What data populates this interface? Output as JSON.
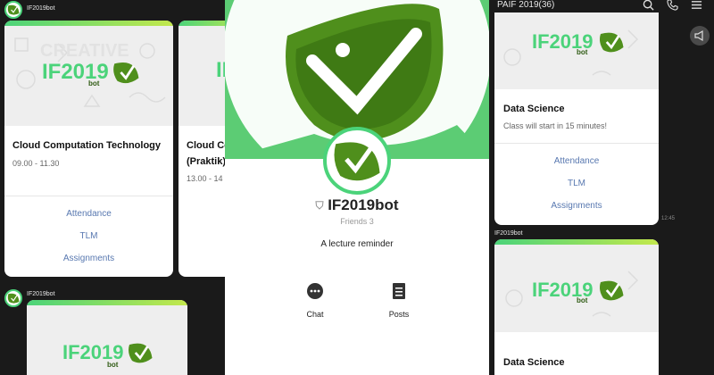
{
  "left": {
    "sender_top": "IF2019bot",
    "sender_bottom": "IF2019bot",
    "cards": [
      {
        "title": "Cloud Computation Technology",
        "time": "09.00 - 11.30",
        "actions": [
          "Attendance",
          "TLM",
          "Assignments"
        ]
      },
      {
        "title_line1": "Cloud Co",
        "title_line2": "(Praktik)",
        "time": "13.00 - 14"
      }
    ]
  },
  "logo": {
    "word": "IF2019",
    "sub": "bot"
  },
  "profile": {
    "name": "IF2019bot",
    "friends": "Friends 3",
    "description": "A lecture reminder",
    "chat_label": "Chat",
    "posts_label": "Posts"
  },
  "right": {
    "chat_title": "PAIF 2019(36)",
    "card1": {
      "title": "Data Science",
      "subtitle": "Class will start in 15 minutes!",
      "actions": [
        "Attendance",
        "TLM",
        "Assignments"
      ]
    },
    "timestamp": "12:45",
    "sender": "IF2019bot",
    "card2": {
      "title": "Data Science"
    }
  },
  "colors": {
    "accent_green": "#4bd37a",
    "leaf_green": "#4f8f1c",
    "link_blue": "#5878b0"
  }
}
